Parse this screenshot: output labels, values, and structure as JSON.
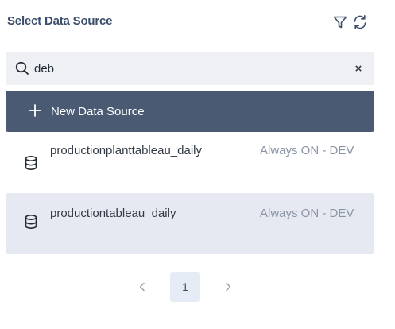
{
  "header": {
    "title": "Select Data Source",
    "icons": [
      "filter-icon",
      "refresh-icon"
    ]
  },
  "search": {
    "value": "deb",
    "clear_label": "×"
  },
  "new_button": {
    "label": "New Data Source"
  },
  "data_sources": [
    {
      "name": "productionplanttableau_daily",
      "env": "Always ON - DEV",
      "selected": false
    },
    {
      "name": "productiontableau_daily",
      "env": "Always ON - DEV",
      "selected": true
    }
  ],
  "pagination": {
    "current_page": "1"
  },
  "colors": {
    "title": "#3d4e6b",
    "primary_button": "#4a5a73",
    "search_bg": "#eef0f4",
    "selected_row": "#e6e9f2",
    "muted_text": "#8a94a6"
  }
}
